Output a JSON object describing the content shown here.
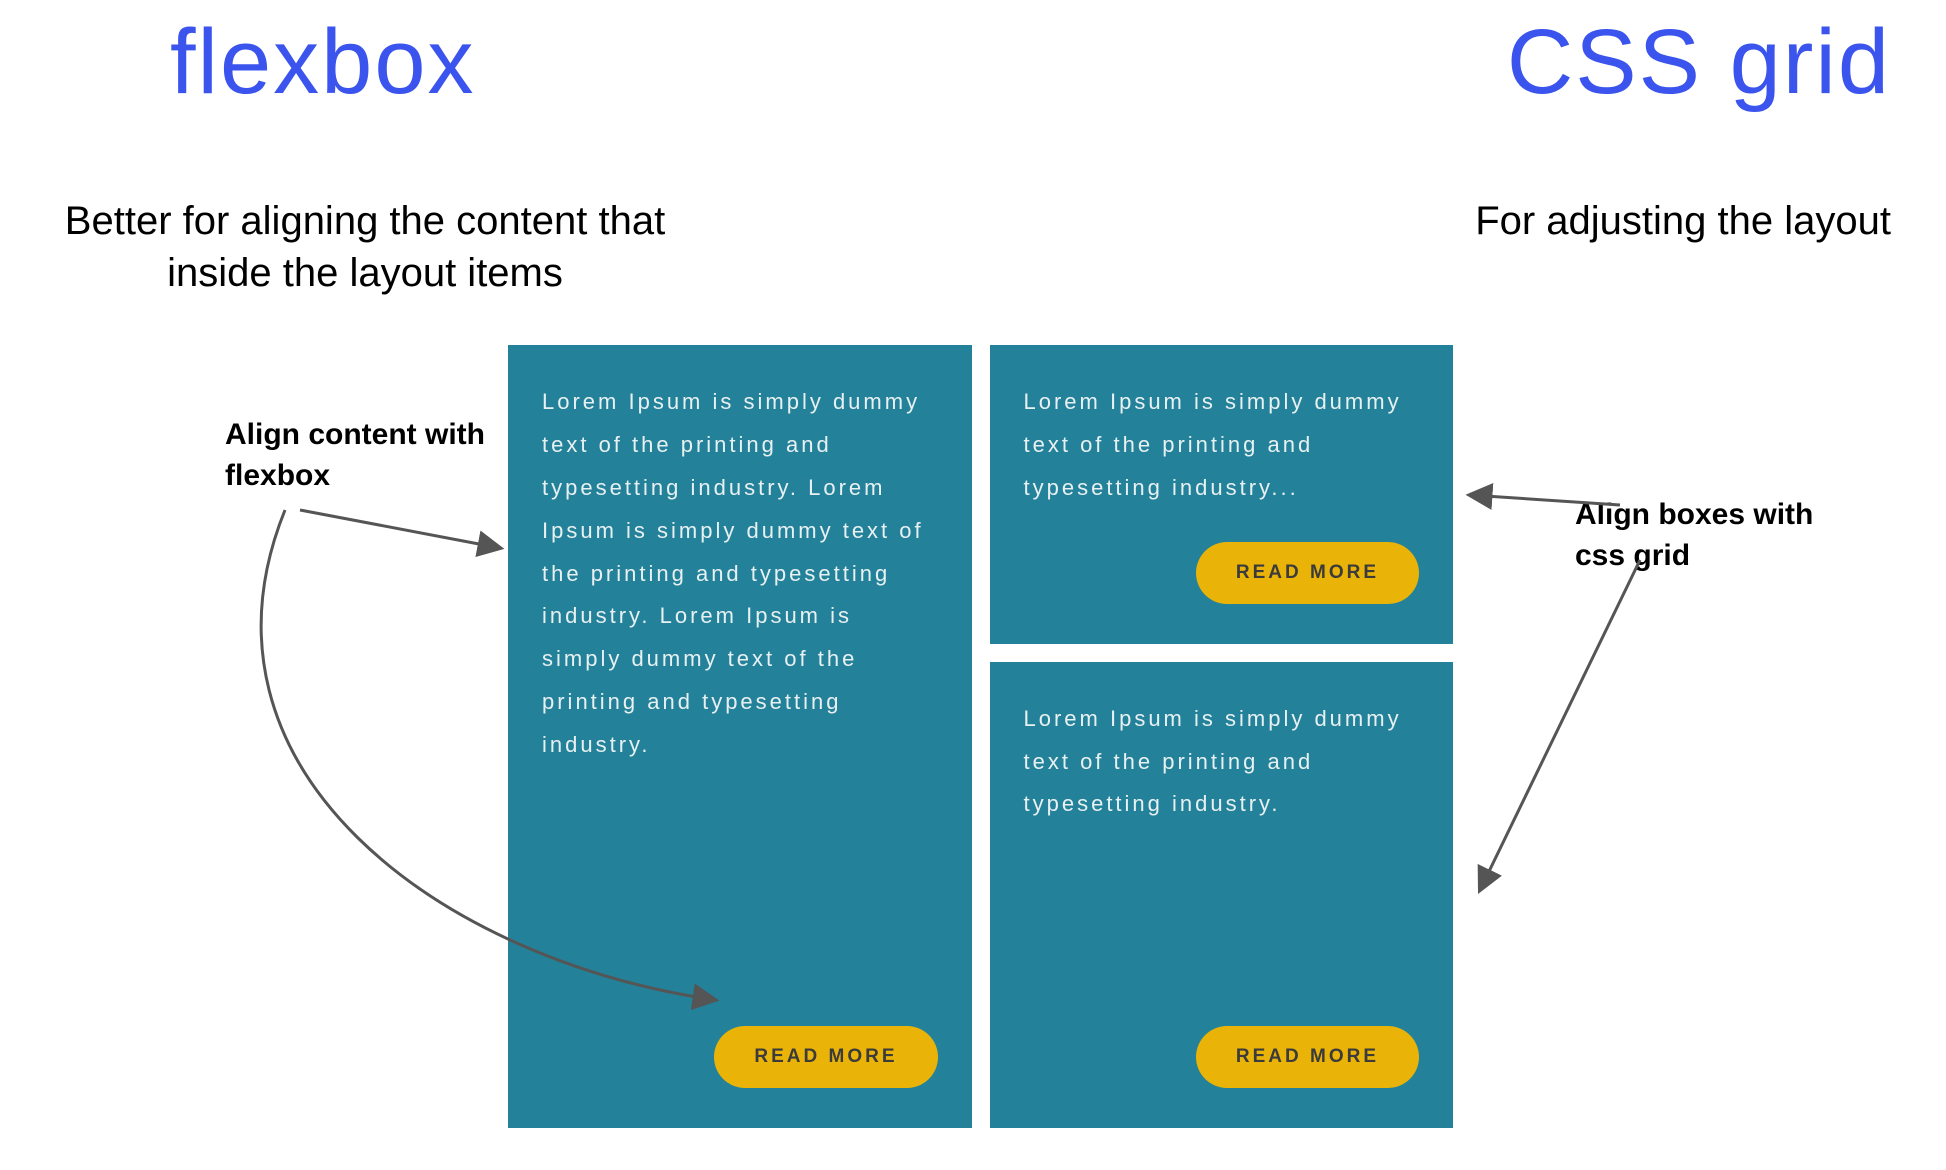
{
  "titles": {
    "flexbox": "flexbox",
    "cssgrid": "CSS grid"
  },
  "subtitles": {
    "flexbox": "Better for aligning the content that inside the layout items",
    "cssgrid": "For adjusting the layout"
  },
  "annotations": {
    "left": "Align content with flexbox",
    "right": "Align boxes with css grid"
  },
  "cards": {
    "a": {
      "text": "Lorem Ipsum is simply dummy text of the printing and typesetting industry. Lorem Ipsum is simply dummy text of the printing and typesetting industry. Lorem Ipsum is simply dummy text of the printing and typesetting industry.",
      "button": "READ MORE"
    },
    "b": {
      "text": "Lorem Ipsum is simply dummy text of the printing and typesetting industry...",
      "button": "READ MORE"
    },
    "c": {
      "text": "Lorem Ipsum is simply dummy text of the printing and typesetting industry.",
      "button": "READ MORE"
    }
  }
}
